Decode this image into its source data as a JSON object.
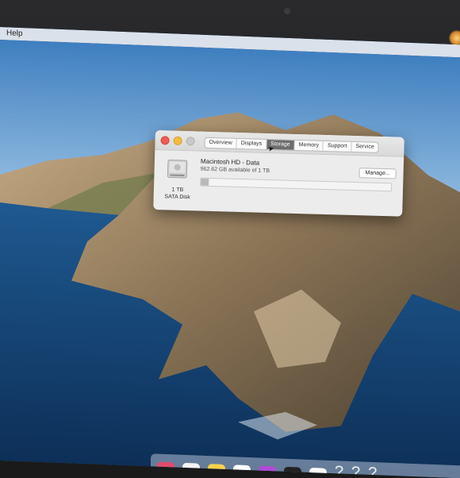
{
  "menubar": {
    "item": "Help"
  },
  "window": {
    "tabs": [
      "Overview",
      "Displays",
      "Storage",
      "Memory",
      "Support",
      "Service"
    ],
    "active_tab": "Storage",
    "disk": {
      "icon": "hard-drive-icon",
      "capacity": "1 TB",
      "type": "SATA Disk",
      "volume_name": "Macintosh HD - Data",
      "availability": "962.62 GB available of 1 TB",
      "used_fraction": 0.04,
      "manage_label": "Manage..."
    }
  },
  "dock": {
    "icons": [
      "app-icon",
      "app-icon",
      "app-icon",
      "app-icon",
      "app-icon",
      "app-icon",
      "app-icon",
      "question-mark-icon",
      "question-mark-icon",
      "question-mark-icon"
    ]
  },
  "colors": {
    "close": "#ee5b55",
    "minimize": "#f2bc3c",
    "zoom_disabled": "#c8c8c8",
    "active_tab": "#6d6d6d"
  }
}
